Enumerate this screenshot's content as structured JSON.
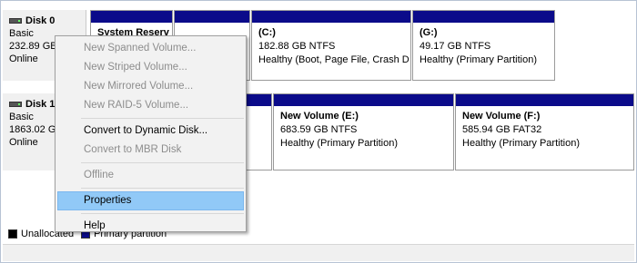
{
  "disks": [
    {
      "name": "Disk 0",
      "type": "Basic",
      "size": "232.89 GB",
      "status": "Online",
      "partitions": [
        {
          "name": "System Reserv",
          "size": "",
          "status": ""
        },
        {
          "name": "",
          "size": "",
          "status": ""
        },
        {
          "name": "(C:)",
          "size": "182.88 GB NTFS",
          "status": "Healthy (Boot, Page File, Crash D"
        },
        {
          "name": "(G:)",
          "size": "49.17 GB NTFS",
          "status": "Healthy (Primary Partition)"
        }
      ]
    },
    {
      "name": "Disk 1",
      "type": "Basic",
      "size": "1863.02 GB",
      "status": "Online",
      "partitions": [
        {
          "name": "",
          "size": "",
          "status": ""
        },
        {
          "name": "New Volume  (E:)",
          "size": "683.59 GB NTFS",
          "status": "Healthy (Primary Partition)"
        },
        {
          "name": "New Volume  (F:)",
          "size": "585.94 GB FAT32",
          "status": "Healthy (Primary Partition)"
        }
      ]
    }
  ],
  "legend": {
    "unallocated": "Unallocated",
    "primary": "Primary partition"
  },
  "colors": {
    "primary_bar": "#0b0b8a",
    "unallocated": "#000000",
    "highlight": "#91c9f7"
  },
  "context_menu": {
    "items": [
      {
        "label": "New Spanned Volume...",
        "enabled": false
      },
      {
        "label": "New Striped Volume...",
        "enabled": false
      },
      {
        "label": "New Mirrored Volume...",
        "enabled": false
      },
      {
        "label": "New RAID-5 Volume...",
        "enabled": false
      },
      {
        "label": "Convert to Dynamic Disk...",
        "enabled": true
      },
      {
        "label": "Convert to MBR Disk",
        "enabled": false
      },
      {
        "label": "Offline",
        "enabled": false
      },
      {
        "label": "Properties",
        "enabled": true,
        "highlighted": true
      },
      {
        "label": "Help",
        "enabled": true
      }
    ]
  }
}
